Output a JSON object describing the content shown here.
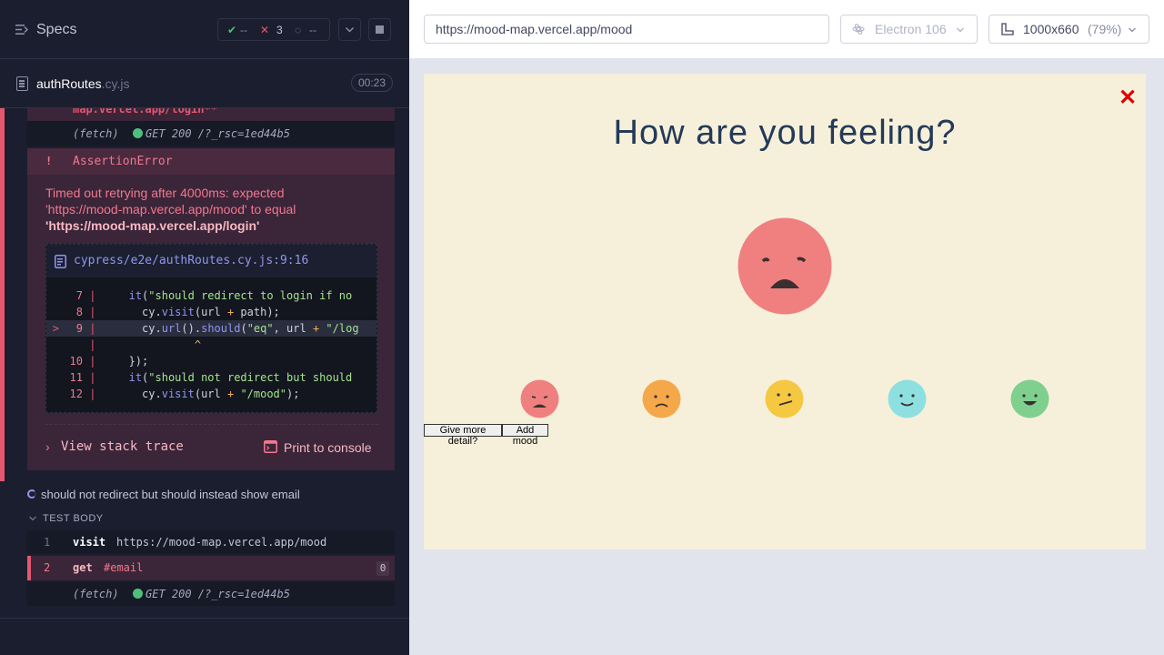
{
  "specs": {
    "title": "Specs",
    "passed": "--",
    "failed": "3",
    "pending": "--"
  },
  "file": {
    "name": "authRoutes",
    "ext": ".cy.js",
    "duration": "00:23"
  },
  "log": {
    "cut_text": "map.vercel.app/login**",
    "fetch1_label": "(fetch)",
    "fetch1_text": "GET 200 /?_rsc=1ed44b5",
    "error_marker": "!",
    "error_type": "AssertionError",
    "error_msg_1": "Timed out retrying after 4000ms: expected",
    "error_msg_2": "'https://mood-map.vercel.app/mood' to equal",
    "error_msg_3": "'https://mood-map.vercel.app/login'",
    "code_file": "cypress/e2e/authRoutes.cy.js:9:16",
    "code_lines": [
      {
        "num": "7",
        "arrow": "",
        "text": "    it(\"should redirect to login if no "
      },
      {
        "num": "8",
        "arrow": "",
        "text": "      cy.visit(url + path);"
      },
      {
        "num": "9",
        "arrow": ">",
        "text": "      cy.url().should(\"eq\", url + \"/log"
      },
      {
        "num": "",
        "arrow": "",
        "text": "              ^"
      },
      {
        "num": "10",
        "arrow": "",
        "text": "    });"
      },
      {
        "num": "11",
        "arrow": "",
        "text": "    it(\"should not redirect but should "
      },
      {
        "num": "12",
        "arrow": "",
        "text": "      cy.visit(url + \"/mood\");"
      }
    ],
    "view_stack": "View stack trace",
    "print_console": "Print to console",
    "test2_title": "should not redirect but should instead show email",
    "test_body": "TEST BODY",
    "cmd1_num": "1",
    "cmd1_name": "visit",
    "cmd1_arg": "https://mood-map.vercel.app/mood",
    "cmd2_num": "2",
    "cmd2_name": "get",
    "cmd2_arg": "#email",
    "cmd2_count": "0",
    "fetch2_label": "(fetch)",
    "fetch2_text": "GET 200 /?_rsc=1ed44b5"
  },
  "browser": {
    "url": "https://mood-map.vercel.app/mood",
    "engine": "Electron 106",
    "viewport": "1000x660",
    "zoom": "(79%)"
  },
  "app": {
    "close": "✕",
    "title": "How are you feeling?",
    "btn_detail": "Give more detail?",
    "btn_add": "Add mood"
  },
  "colors": {
    "fail": "#e45770",
    "pass": "#4fbf7e",
    "mood_angry": "#f08080",
    "mood_sad": "#f5a84a",
    "mood_meh": "#f5c842",
    "mood_ok": "#8ee0e0",
    "mood_happy": "#7fd08f"
  }
}
